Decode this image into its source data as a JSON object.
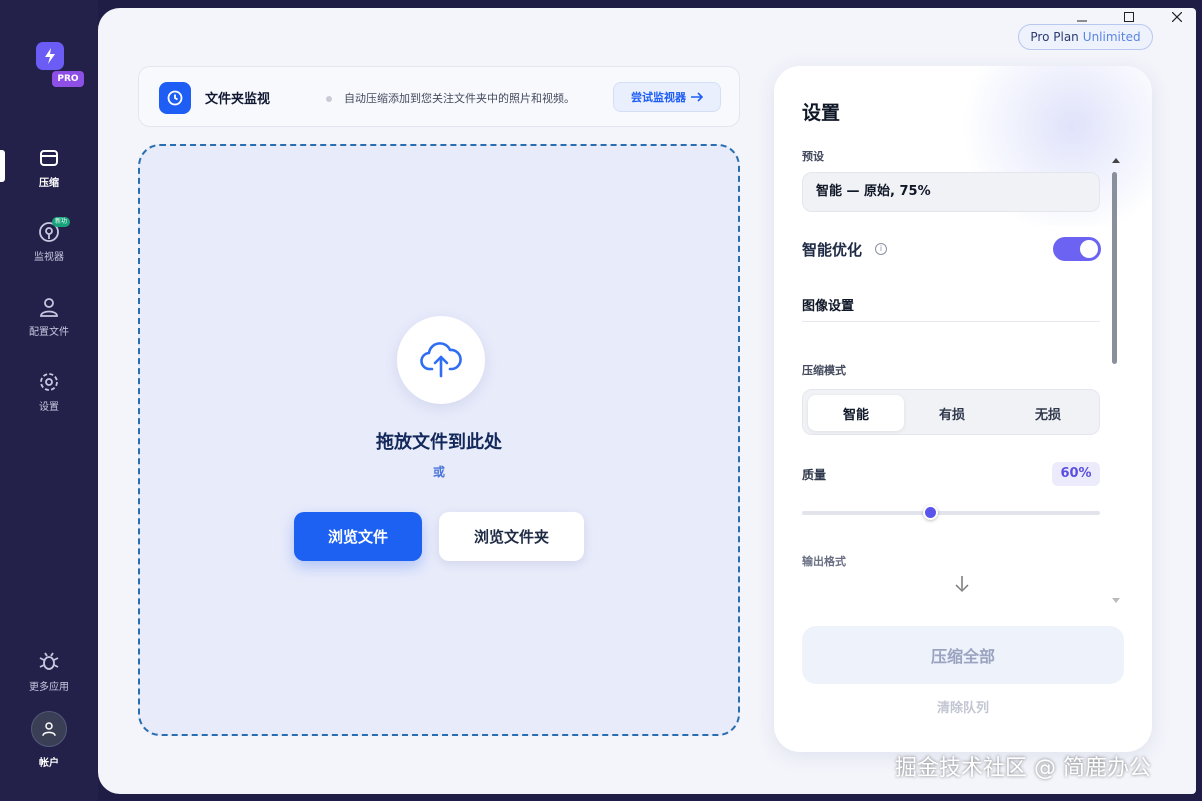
{
  "sidebar": {
    "logo_badge": "PRO",
    "items": [
      {
        "label": "压缩",
        "icon": "archive-icon",
        "active": true
      },
      {
        "label": "监视器",
        "icon": "monitor-eye-icon",
        "badge": "新功"
      },
      {
        "label": "配置文件",
        "icon": "user-profile-icon"
      },
      {
        "label": "设置",
        "icon": "gear-icon"
      },
      {
        "label": "更多应用",
        "icon": "bug-icon"
      }
    ],
    "account_label": "帐户"
  },
  "window": {
    "plan_name": "Pro Plan",
    "plan_tier": "Unlimited"
  },
  "banner": {
    "icon": "clock-icon",
    "title": "文件夹监视",
    "description": "自动压缩添加到您关注文件夹中的照片和视频。",
    "button": "尝试监视器"
  },
  "dropzone": {
    "icon": "cloud-upload-icon",
    "title": "拖放文件到此处",
    "or": "或",
    "browse_files": "浏览文件",
    "browse_folder": "浏览文件夹"
  },
  "settings": {
    "title": "设置",
    "preset_label": "预设",
    "preset_value": "智能 — 原始, 75%",
    "smart_opt_label": "智能优化",
    "smart_opt_enabled": true,
    "image_section": "图像设置",
    "mode_label": "压缩模式",
    "modes": [
      "智能",
      "有损",
      "无损"
    ],
    "mode_selected": "智能",
    "quality_label": "质量",
    "quality_value": "60%",
    "quality_fraction": 0.43,
    "format_label": "输出格式",
    "compress_all": "压缩全部",
    "clear_queue": "清除队列"
  },
  "watermark": "掘金技术社区 @ 简鹿办公",
  "colors": {
    "accent": "#1c61f2",
    "toggle": "#6c63f2",
    "sidebar": "#232149"
  }
}
